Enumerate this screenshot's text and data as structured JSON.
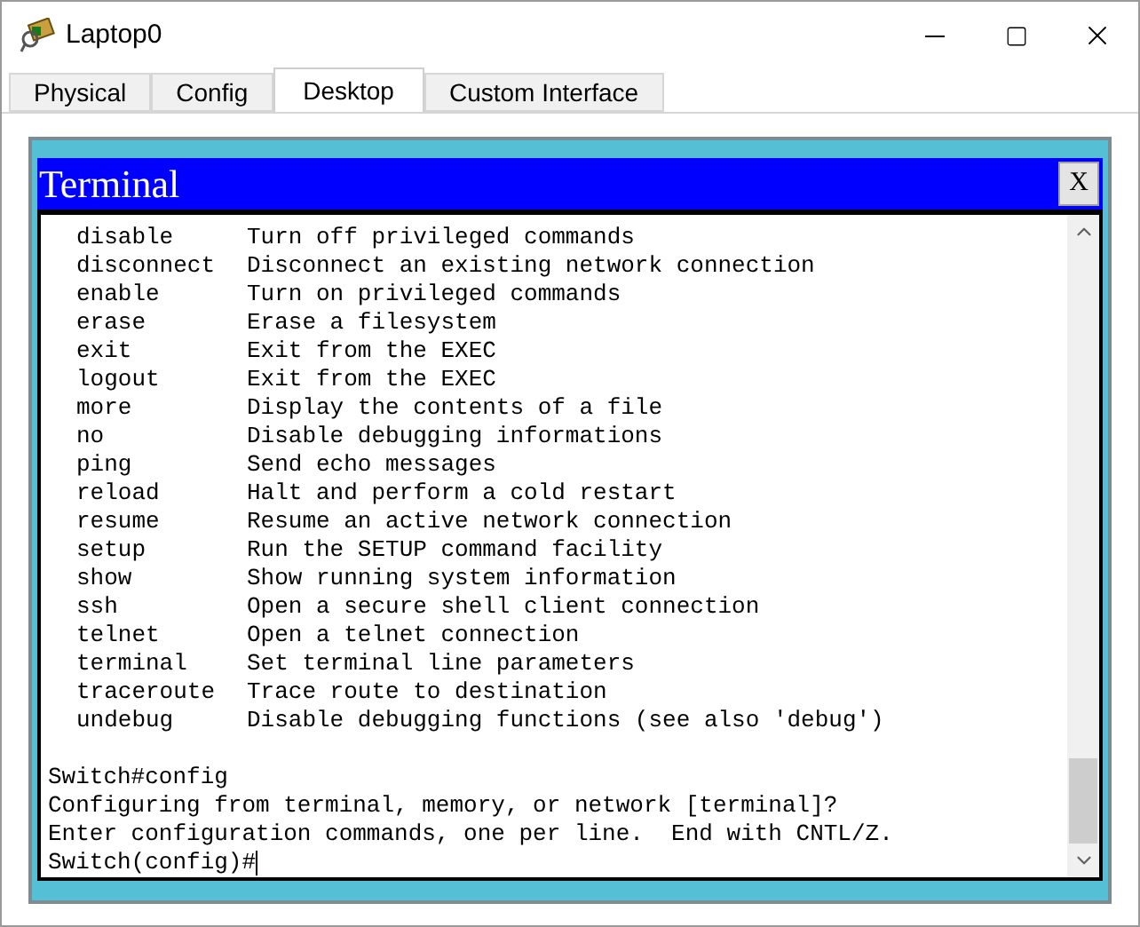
{
  "window": {
    "title": "Laptop0"
  },
  "tabs": [
    {
      "label": "Physical",
      "selected": false
    },
    {
      "label": "Config",
      "selected": false
    },
    {
      "label": "Desktop",
      "selected": true
    },
    {
      "label": "Custom Interface",
      "selected": false
    }
  ],
  "terminal": {
    "title": "Terminal",
    "close_label": "X",
    "commands": [
      {
        "command": "disable",
        "description": "Turn off privileged commands"
      },
      {
        "command": "disconnect",
        "description": "Disconnect an existing network connection"
      },
      {
        "command": "enable",
        "description": "Turn on privileged commands"
      },
      {
        "command": "erase",
        "description": "Erase a filesystem"
      },
      {
        "command": "exit",
        "description": "Exit from the EXEC"
      },
      {
        "command": "logout",
        "description": "Exit from the EXEC"
      },
      {
        "command": "more",
        "description": "Display the contents of a file"
      },
      {
        "command": "no",
        "description": "Disable debugging informations"
      },
      {
        "command": "ping",
        "description": "Send echo messages"
      },
      {
        "command": "reload",
        "description": "Halt and perform a cold restart"
      },
      {
        "command": "resume",
        "description": "Resume an active network connection"
      },
      {
        "command": "setup",
        "description": "Run the SETUP command facility"
      },
      {
        "command": "show",
        "description": "Show running system information"
      },
      {
        "command": "ssh",
        "description": "Open a secure shell client connection"
      },
      {
        "command": "telnet",
        "description": "Open a telnet connection"
      },
      {
        "command": "terminal",
        "description": "Set terminal line parameters"
      },
      {
        "command": "traceroute",
        "description": "Trace route to destination"
      },
      {
        "command": "undebug",
        "description": "Disable debugging functions (see also 'debug')"
      }
    ],
    "output": [
      "Switch#config",
      "Configuring from terminal, memory, or network [terminal]?",
      "Enter configuration commands, one per line.  End with CNTL/Z."
    ],
    "prompt": "Switch(config)#"
  }
}
